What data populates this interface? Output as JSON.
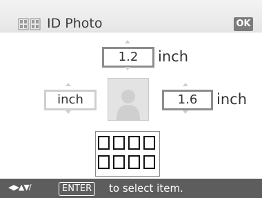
{
  "header": {
    "icon": "photo-sheet-icon",
    "title": "ID Photo",
    "ok_label": "OK"
  },
  "size_fields": {
    "top": {
      "value": "1.2",
      "unit": "inch"
    },
    "left": {
      "value": "inch"
    },
    "right": {
      "value": "1.6",
      "unit": "inch"
    }
  },
  "preview": {
    "icon": "person-silhouette-icon"
  },
  "layout": {
    "icon": "print-grid-icon"
  },
  "footer": {
    "nav_icon": "dpad-arrows-icon",
    "nav_glyphs": "◀▶▲▼/",
    "enter_label": "ENTER",
    "hint": "to select item."
  },
  "colors": {
    "footer_bg": "#5d5d5d",
    "ok_bg": "#7c7c7c",
    "field_border": "#cfcfcf",
    "active_field_border": "#8c8c8c"
  }
}
